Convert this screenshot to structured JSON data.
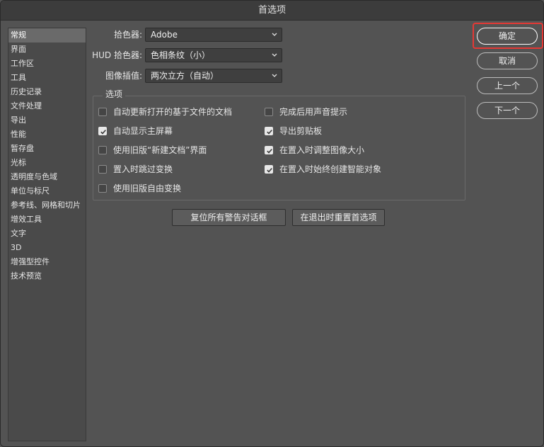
{
  "window": {
    "title": "首选项"
  },
  "sidebar": {
    "items": [
      {
        "label": "常规",
        "selected": true
      },
      {
        "label": "界面"
      },
      {
        "label": "工作区"
      },
      {
        "label": "工具"
      },
      {
        "label": "历史记录"
      },
      {
        "label": "文件处理"
      },
      {
        "label": "导出"
      },
      {
        "label": "性能"
      },
      {
        "label": "暂存盘"
      },
      {
        "label": "光标"
      },
      {
        "label": "透明度与色域"
      },
      {
        "label": "单位与标尺"
      },
      {
        "label": "参考线、网格和切片"
      },
      {
        "label": "增效工具"
      },
      {
        "label": "文字"
      },
      {
        "label": "3D"
      },
      {
        "label": "增强型控件"
      },
      {
        "label": "技术预览"
      }
    ]
  },
  "fields": {
    "color_picker": {
      "label": "拾色器:",
      "value": "Adobe"
    },
    "hud_color_picker": {
      "label": "HUD 拾色器:",
      "value": "色相条纹（小）"
    },
    "image_interpolation": {
      "label": "图像插值:",
      "value": "两次立方（自动）"
    }
  },
  "options": {
    "title": "选项",
    "left": [
      {
        "label": "自动更新打开的基于文件的文档",
        "checked": false
      },
      {
        "label": "自动显示主屏幕",
        "checked": true
      },
      {
        "label": "使用旧版“新建文档”界面",
        "checked": false
      },
      {
        "label": "置入时跳过变换",
        "checked": false
      },
      {
        "label": "使用旧版自由变换",
        "checked": false
      }
    ],
    "right": [
      {
        "label": "完成后用声音提示",
        "checked": false
      },
      {
        "label": "导出剪贴板",
        "checked": true
      },
      {
        "label": "在置入时调整图像大小",
        "checked": true
      },
      {
        "label": "在置入时始终创建智能对象",
        "checked": true
      }
    ]
  },
  "actions": {
    "reset_warnings": "复位所有警告对话框",
    "reset_prefs_on_quit": "在退出时重置首选项"
  },
  "buttons": {
    "ok": "确定",
    "cancel": "取消",
    "prev": "上一个",
    "next": "下一个"
  },
  "colors": {
    "background": "#535353",
    "highlight": "#e53935",
    "selected_item": "#6a6a6a"
  }
}
